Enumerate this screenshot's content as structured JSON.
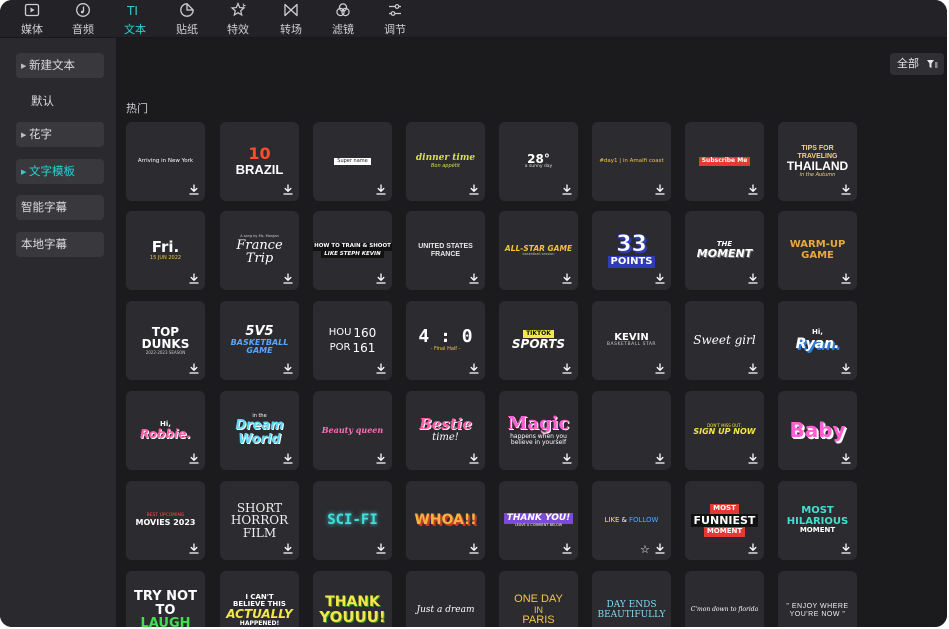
{
  "tabs": [
    {
      "icon": "media-icon",
      "label": "媒体",
      "active": false
    },
    {
      "icon": "audio-icon",
      "label": "音频",
      "active": false
    },
    {
      "icon": "text-icon",
      "label": "文本",
      "active": true
    },
    {
      "icon": "sticker-icon",
      "label": "贴纸",
      "active": false
    },
    {
      "icon": "effects-icon",
      "label": "特效",
      "active": false
    },
    {
      "icon": "transition-icon",
      "label": "转场",
      "active": false
    },
    {
      "icon": "filter-icon",
      "label": "滤镜",
      "active": false
    },
    {
      "icon": "adjust-icon",
      "label": "调节",
      "active": false
    }
  ],
  "sidebar": {
    "items": [
      {
        "label": "新建文本",
        "expandable": true,
        "active": false
      },
      {
        "label": "默认",
        "expandable": false,
        "active": false
      },
      {
        "label": "花字",
        "expandable": true,
        "active": false
      },
      {
        "label": "文字模板",
        "expandable": true,
        "active": true
      },
      {
        "label": "智能字幕",
        "expandable": false,
        "active": false
      },
      {
        "label": "本地字幕",
        "expandable": false,
        "active": false
      }
    ]
  },
  "main": {
    "filter_label": "全部",
    "section_title": "热门",
    "templates": [
      {
        "lines": [
          "Arriving in New York"
        ],
        "style": "arriving"
      },
      {
        "lines": [
          "10",
          "BRAZIL"
        ],
        "style": "brazil"
      },
      {
        "lines": [
          "Super name"
        ],
        "style": "searchbar"
      },
      {
        "lines": [
          "dinner time",
          "Bon appétit"
        ],
        "style": "dinner"
      },
      {
        "lines": [
          "28°",
          "a sunny day"
        ],
        "style": "weather"
      },
      {
        "lines": [
          "#day1 | in Amalfi coast"
        ],
        "style": "amalfi"
      },
      {
        "lines": [
          "Subscribe Me"
        ],
        "style": "subscribe"
      },
      {
        "lines": [
          "TIPS FOR",
          "TRAVELING",
          "THAILAND",
          "in the Autumn"
        ],
        "style": "thailand"
      },
      {
        "lines": [
          "Fri.",
          "15 JUN 2022"
        ],
        "style": "fri"
      },
      {
        "lines": [
          "A song by Ms. Morgan",
          "France",
          "Trip"
        ],
        "style": "france"
      },
      {
        "lines": [
          "HOW TO TRAIN & SHOOT",
          "LIKE STEPH KEVIN"
        ],
        "style": "howto"
      },
      {
        "lines": [
          "UNITED STATES",
          "FRANCE"
        ],
        "style": "usfrance"
      },
      {
        "lines": [
          "ALL-STAR GAME",
          "basketball session"
        ],
        "style": "allstar"
      },
      {
        "lines": [
          "33",
          "POINTS"
        ],
        "style": "points"
      },
      {
        "lines": [
          "THE",
          "MOMENT"
        ],
        "style": "moment"
      },
      {
        "lines": [
          "WARM-UP",
          "GAME"
        ],
        "style": "warmup"
      },
      {
        "lines": [
          "TOP",
          "DUNKS",
          "2022-2023 SEASON"
        ],
        "style": "dunks"
      },
      {
        "lines": [
          "5V5",
          "BASKETBALL",
          "GAME"
        ],
        "style": "fivev"
      },
      {
        "lines": [
          "HOU",
          "160",
          "POR",
          "161"
        ],
        "style": "score"
      },
      {
        "lines": [
          "4 : 0",
          "- Final Half -"
        ],
        "style": "fourzero"
      },
      {
        "lines": [
          "TIKTOK",
          "SPORTS"
        ],
        "style": "tiktok"
      },
      {
        "lines": [
          "KEVIN",
          "BASKETBALL STAR"
        ],
        "style": "kevin"
      },
      {
        "lines": [
          "Sweet girl"
        ],
        "style": "sweet"
      },
      {
        "lines": [
          "Hi,",
          "Ryan."
        ],
        "style": "ryan"
      },
      {
        "lines": [
          "Hi,",
          "Robbie."
        ],
        "style": "robbie"
      },
      {
        "lines": [
          "in the",
          "Dream",
          "World"
        ],
        "style": "dream"
      },
      {
        "lines": [
          "Beauty queen"
        ],
        "style": "beauty"
      },
      {
        "lines": [
          "Bestie",
          "time!"
        ],
        "style": "bestie"
      },
      {
        "lines": [
          "Magic",
          "happens when you",
          "believe in yourself"
        ],
        "style": "magic"
      },
      {
        "lines": [],
        "style": "empty"
      },
      {
        "lines": [
          "DON'T MISS OUT,",
          "SIGN UP NOW"
        ],
        "style": "signup"
      },
      {
        "lines": [
          "Baby"
        ],
        "style": "baby"
      },
      {
        "lines": [
          "BEST UPCOMING",
          "MOVIES 2023"
        ],
        "style": "movies"
      },
      {
        "lines": [
          "SHORT",
          "HORROR",
          "FILM"
        ],
        "style": "horror"
      },
      {
        "lines": [
          "SCI-FI"
        ],
        "style": "scifi"
      },
      {
        "lines": [
          "WHOA!!"
        ],
        "style": "whoa"
      },
      {
        "lines": [
          "THANK YOU!",
          "LEAVE A COMMENT BELOW"
        ],
        "style": "thankyou"
      },
      {
        "lines": [
          "LIKE",
          "&",
          "FOLLOW"
        ],
        "style": "likefollow"
      },
      {
        "lines": [
          "MOST",
          "FUNNIEST",
          "MOMENT"
        ],
        "style": "funniest"
      },
      {
        "lines": [
          "MOST",
          "HILARIOUS",
          "MOMENT"
        ],
        "style": "hilarious"
      },
      {
        "lines": [
          "TRY NOT",
          "TO",
          "LAUGH"
        ],
        "style": "trynot"
      },
      {
        "lines": [
          "I CAN'T",
          "BELIEVE THIS",
          "ACTUALLY",
          "HAPPENED!"
        ],
        "style": "cantbelieve"
      },
      {
        "lines": [
          "THANK",
          "YOUUU!"
        ],
        "style": "thankyouuu"
      },
      {
        "lines": [
          "Just a dream"
        ],
        "style": "justdream"
      },
      {
        "lines": [
          "ONE DAY",
          "IN",
          "PARIS"
        ],
        "style": "paris"
      },
      {
        "lines": [
          "DAY ENDS",
          "BEAUTIFULLY"
        ],
        "style": "dayends"
      },
      {
        "lines": [
          "C'mon down to florida"
        ],
        "style": "florida"
      },
      {
        "lines": [
          "\" ENJOY WHERE",
          "YOU'RE NOW \""
        ],
        "style": "enjoy"
      }
    ]
  },
  "colors": {
    "accent": "#27d3d1",
    "app_bg": "#1b1b1e",
    "sidebar_bg": "#2a2a2e",
    "card_bg": "#2c2c30"
  }
}
